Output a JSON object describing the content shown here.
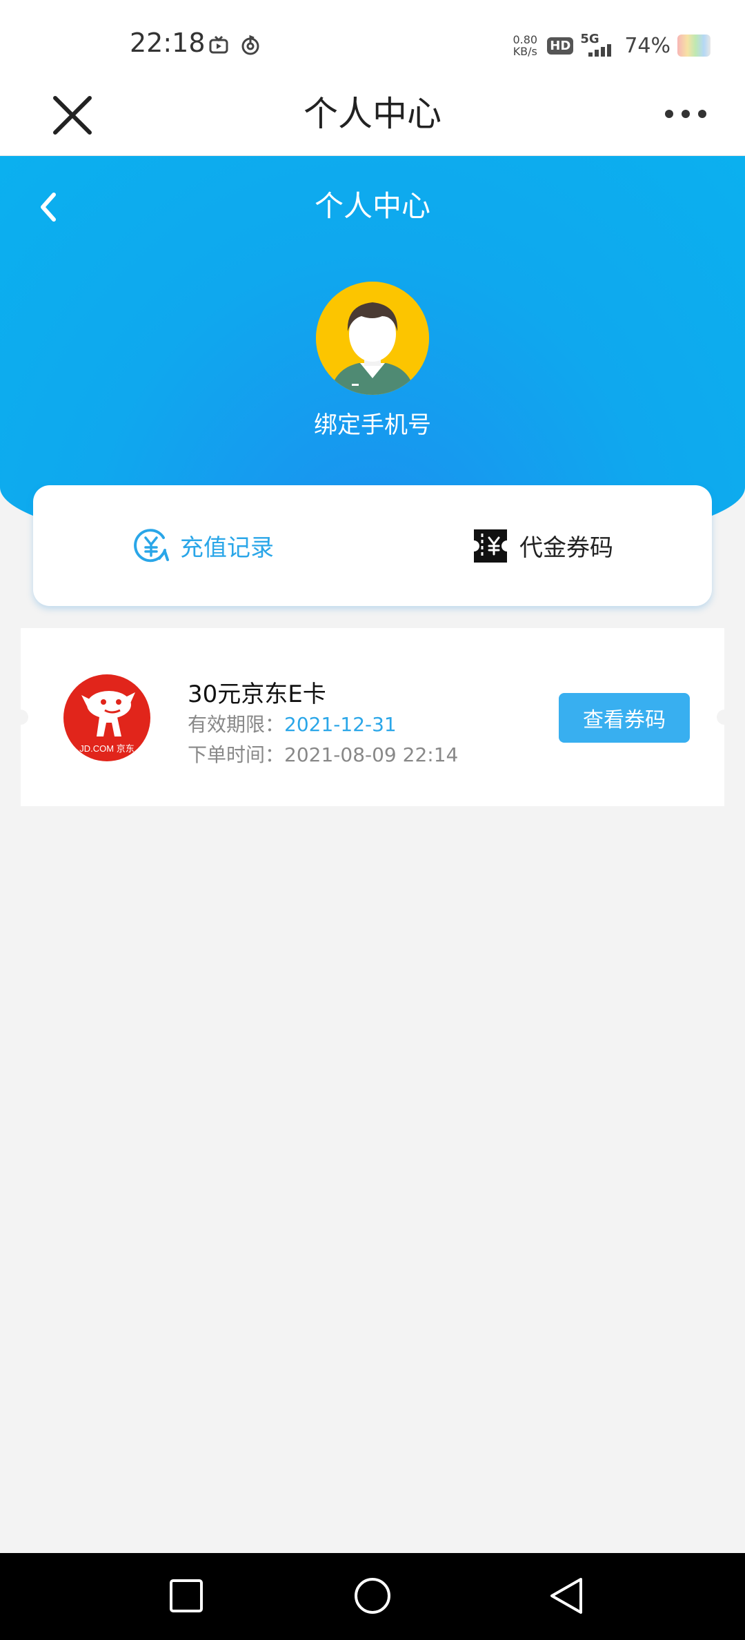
{
  "status_bar": {
    "time": "22:18",
    "net_speed_value": "0.80",
    "net_speed_unit": "KB/s",
    "hd_label": "HD",
    "network_label": "5G",
    "battery_percent": "74%"
  },
  "header": {
    "title": "个人中心",
    "close_icon": "close-icon",
    "more_icon": "more-icon"
  },
  "hero": {
    "title": "个人中心",
    "bind_phone_label": "绑定手机号",
    "background_color": "#0fa8ee"
  },
  "tabs": [
    {
      "label": "充值记录",
      "icon": "yen-refresh-icon",
      "active": true,
      "color": "#2aa6e8"
    },
    {
      "label": "代金券码",
      "icon": "voucher-icon",
      "active": false,
      "color": "#222222"
    }
  ],
  "coupons": [
    {
      "logo_text": "JD.COM 京东",
      "title": "30元京东E卡",
      "expiry_label": "有效期限：",
      "expiry_value": "2021-12-31",
      "order_label": "下单时间：",
      "order_value": "2021-08-09 22:14",
      "action_label": "查看券码"
    }
  ],
  "colors": {
    "accent": "#38aff0",
    "link": "#2aa6e8",
    "jd_red": "#e1251b"
  }
}
